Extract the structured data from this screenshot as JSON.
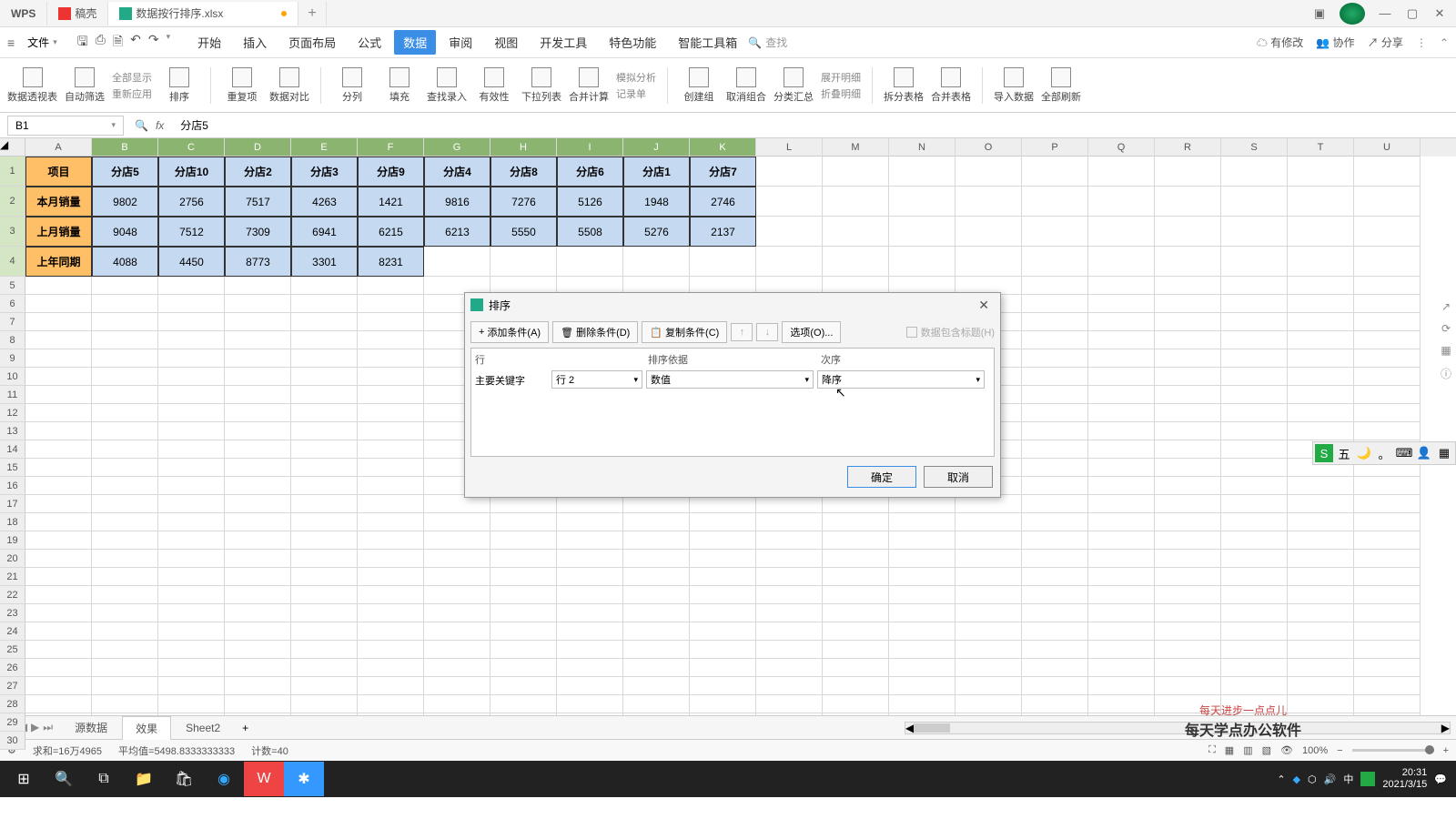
{
  "tabs": {
    "wps": "WPS",
    "t1": "稿壳",
    "t2": "数据按行排序.xlsx"
  },
  "menu": {
    "file": "文件",
    "start": "开始",
    "insert": "插入",
    "layout": "页面布局",
    "formula": "公式",
    "data": "数据",
    "review": "审阅",
    "view": "视图",
    "dev": "开发工具",
    "special": "特色功能",
    "smart": "智能工具箱"
  },
  "search": "查找",
  "topright": {
    "changes": "有修改",
    "collab": "协作",
    "share": "分享"
  },
  "ribbon": {
    "pivot": "数据透视表",
    "filter": "自动筛选",
    "showall": "全部显示",
    "reapply": "重新应用",
    "sort": "排序",
    "dup": "重复项",
    "compare": "数据对比",
    "split": "分列",
    "fill": "填充",
    "find": "查找录入",
    "valid": "有效性",
    "dropdown": "下拉列表",
    "consol": "合并计算",
    "sim": "模拟分析",
    "form": "记录单",
    "group": "创建组",
    "ungroup": "取消组合",
    "subtotal": "分类汇总",
    "expand": "展开明细",
    "collapse": "折叠明细",
    "splittbl": "拆分表格",
    "mergetbl": "合并表格",
    "import": "导入数据",
    "refresh": "全部刷新"
  },
  "namebox": "B1",
  "formula": "分店5",
  "cols": [
    "A",
    "B",
    "C",
    "D",
    "E",
    "F",
    "G",
    "H",
    "I",
    "J",
    "K",
    "L",
    "M",
    "N",
    "O",
    "P",
    "Q",
    "R",
    "S",
    "T",
    "U"
  ],
  "data": {
    "header": [
      "项目",
      "分店5",
      "分店10",
      "分店2",
      "分店3",
      "分店9",
      "分店4",
      "分店8",
      "分店6",
      "分店1",
      "分店7"
    ],
    "r2": [
      "本月销量",
      "9802",
      "2756",
      "7517",
      "4263",
      "1421",
      "9816",
      "7276",
      "5126",
      "1948",
      "2746"
    ],
    "r3": [
      "上月销量",
      "9048",
      "7512",
      "7309",
      "6941",
      "6215",
      "6213",
      "5550",
      "5508",
      "5276",
      "2137"
    ],
    "r4": [
      "上年同期",
      "4088",
      "4450",
      "8773",
      "3301",
      "8231"
    ]
  },
  "sheets": {
    "s1": "源数据",
    "s2": "效果",
    "s3": "Sheet2"
  },
  "status": {
    "sum": "求和=16万4965",
    "avg": "平均值=5498.8333333333",
    "count": "计数=40",
    "zoom": "100%"
  },
  "dialog": {
    "title": "排序",
    "add": "添加条件(A)",
    "del": "删除条件(D)",
    "copy": "复制条件(C)",
    "options": "选项(O)...",
    "checkbox": "数据包含标题(H)",
    "col_row": "行",
    "col_basis": "排序依据",
    "col_order": "次序",
    "keyword": "主要关键字",
    "row_val": "行 2",
    "basis_val": "数值",
    "order_val": "降序",
    "ok": "确定",
    "cancel": "取消"
  },
  "watermark": {
    "small": "每天进步一点点儿",
    "big": "每天学点办公软件"
  },
  "clock": {
    "time": "20:31",
    "date": "2021/3/15"
  }
}
